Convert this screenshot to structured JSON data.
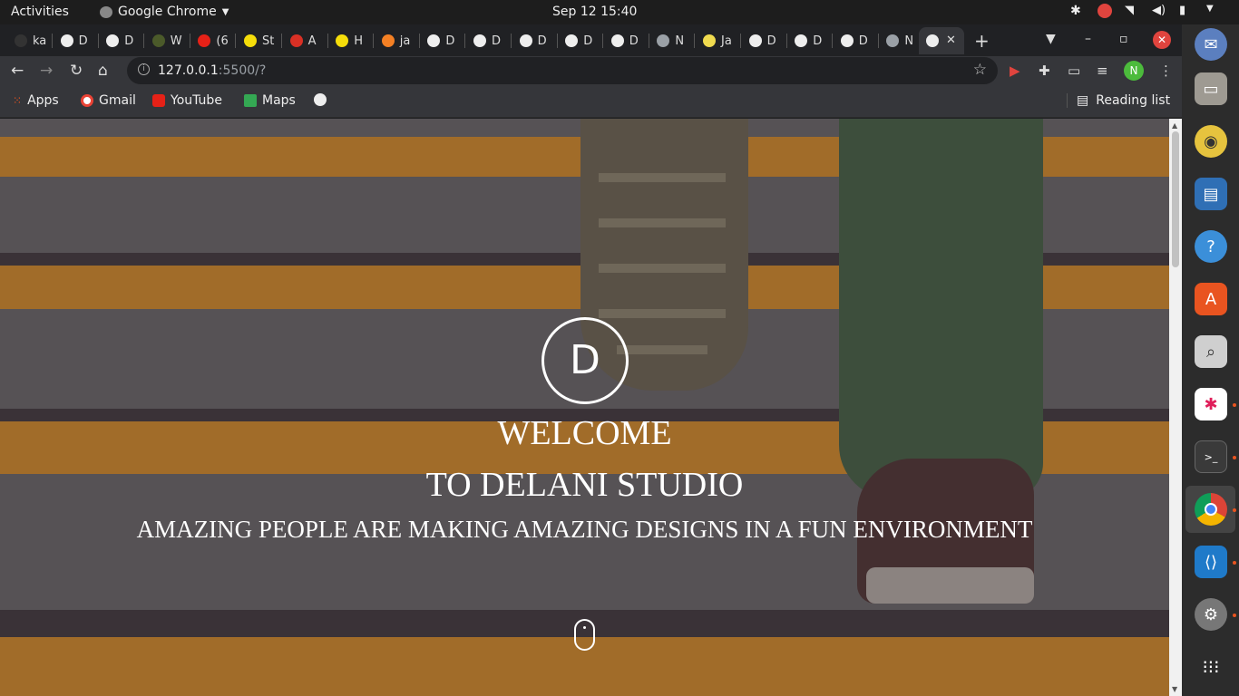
{
  "topbar": {
    "activities": "Activities",
    "app_name": "Google Chrome",
    "clock": "Sep 12  15:40"
  },
  "tabs": [
    {
      "label": "ka",
      "fav_color": "#333"
    },
    {
      "label": "D",
      "fav_color": "#eee"
    },
    {
      "label": "D",
      "fav_color": "#eee"
    },
    {
      "label": "W",
      "fav_color": "#4b5a2a"
    },
    {
      "label": "(6",
      "fav_color": "#e62117"
    },
    {
      "label": "St",
      "fav_color": "#f5dd0a"
    },
    {
      "label": "A",
      "fav_color": "#d93025"
    },
    {
      "label": "H",
      "fav_color": "#f5dd0a"
    },
    {
      "label": "ja",
      "fav_color": "#f48024"
    },
    {
      "label": "D",
      "fav_color": "#eee"
    },
    {
      "label": "D",
      "fav_color": "#eee"
    },
    {
      "label": "D",
      "fav_color": "#eee"
    },
    {
      "label": "D",
      "fav_color": "#eee"
    },
    {
      "label": "D",
      "fav_color": "#eee"
    },
    {
      "label": "N",
      "fav_color": "#9aa0a6"
    },
    {
      "label": "Ja",
      "fav_color": "#f0db4f"
    },
    {
      "label": "D",
      "fav_color": "#eee"
    },
    {
      "label": "D",
      "fav_color": "#eee"
    },
    {
      "label": "D",
      "fav_color": "#eee"
    },
    {
      "label": "N",
      "fav_color": "#9aa0a6"
    }
  ],
  "toolbar": {
    "url_host": "127.0.0.1",
    "url_rest": ":5500/?",
    "profile_initial": "N"
  },
  "bookmarks": {
    "apps": "Apps",
    "gmail": "Gmail",
    "youtube": "YouTube",
    "maps": "Maps",
    "reading_list": "Reading list"
  },
  "page": {
    "logo_letter": "D",
    "heading_line1": "WELCOME",
    "heading_line2": "TO DELANI STUDIO",
    "tagline": "AMAZING PEOPLE ARE MAKING AMAZING DESIGNS IN A FUN ENVIRONMENT"
  },
  "dock": {
    "items": [
      "files-icon",
      "rhythmbox-icon",
      "writer-icon",
      "help-icon",
      "software-icon",
      "search-icon",
      "slack-icon",
      "terminal-icon",
      "chrome-icon",
      "vscode-icon",
      "settings-icon",
      "show-apps-icon"
    ]
  }
}
